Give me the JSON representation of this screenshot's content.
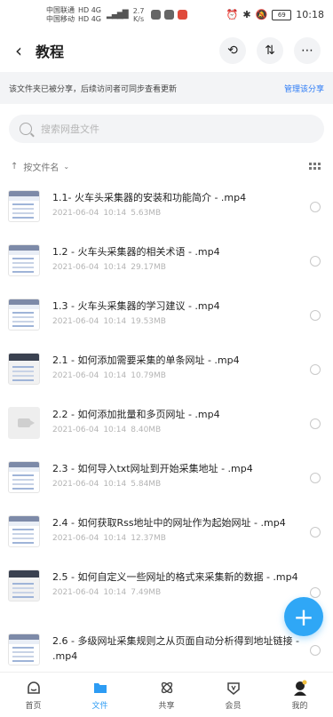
{
  "status_bar": {
    "carrier1": "中国联通",
    "carrier2": "中国移动",
    "net1": "HD 4G",
    "net2": "HD 4G",
    "speed": "2.7",
    "speed_unit": "K/s",
    "battery": "69",
    "time": "10:18"
  },
  "header": {
    "title": "教程",
    "icons": [
      "history-icon",
      "sort-icon",
      "more-icon"
    ]
  },
  "banner": {
    "text": "该文件夹已被分享，后续访问者可同步查看更新",
    "action": "管理该分享"
  },
  "search": {
    "placeholder": "搜索网盘文件"
  },
  "sort": {
    "label": "按文件名"
  },
  "files": [
    {
      "name": "1.1- 火车头采集器的安装和功能简介 - .mp4",
      "date": "2021-06-04",
      "time": "10:14",
      "size": "5.63MB"
    },
    {
      "name": "1.2 - 火车头采集器的相关术语 - .mp4",
      "date": "2021-06-04",
      "time": "10:14",
      "size": "29.17MB"
    },
    {
      "name": "1.3 - 火车头采集器的学习建议 - .mp4",
      "date": "2021-06-04",
      "time": "10:14",
      "size": "19.53MB"
    },
    {
      "name": "2.1 - 如何添加需要采集的单条网址 - .mp4",
      "date": "2021-06-04",
      "time": "10:14",
      "size": "10.79MB"
    },
    {
      "name": "2.2 - 如何添加批量和多页网址 - .mp4",
      "date": "2021-06-04",
      "time": "10:14",
      "size": "8.40MB"
    },
    {
      "name": "2.3 - 如何导入txt网址到开始采集地址 - .mp4",
      "date": "2021-06-04",
      "time": "10:14",
      "size": "5.84MB"
    },
    {
      "name": "2.4 - 如何获取Rss地址中的网址作为起始网址 - .mp4",
      "date": "2021-06-04",
      "time": "10:14",
      "size": "12.37MB"
    },
    {
      "name": "2.5 - 如何自定义一些网址的格式来采集新的数据 - .mp4",
      "date": "2021-06-04",
      "time": "10:14",
      "size": "7.49MB"
    },
    {
      "name": "2.6 - 多级网址采集规则之从页面自动分析得到地址链接 - .mp4",
      "date": "",
      "time": "",
      "size": ""
    }
  ],
  "tabs": [
    {
      "label": "首页",
      "icon": "home-icon"
    },
    {
      "label": "文件",
      "icon": "folder-icon"
    },
    {
      "label": "共享",
      "icon": "share-icon"
    },
    {
      "label": "会员",
      "icon": "vip-icon"
    },
    {
      "label": "我的",
      "icon": "avatar-icon"
    }
  ],
  "colors": {
    "accent": "#2d9cf4",
    "fab": "#2fa7f6",
    "banner_bg": "#f3f4f6"
  }
}
